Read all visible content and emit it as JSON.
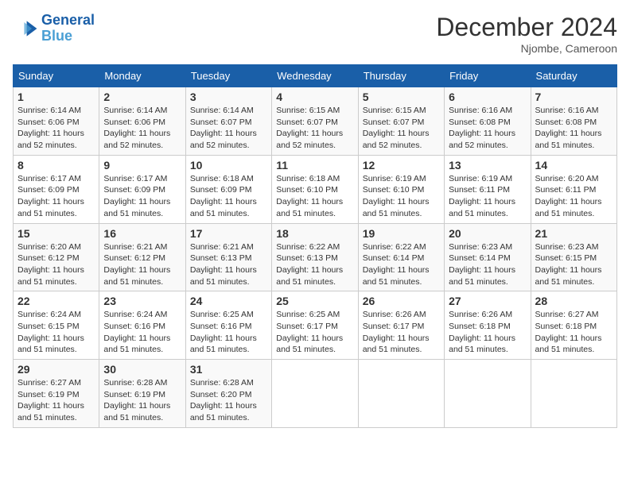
{
  "header": {
    "logo_line1": "General",
    "logo_line2": "Blue",
    "month_year": "December 2024",
    "location": "Njombe, Cameroon"
  },
  "days_of_week": [
    "Sunday",
    "Monday",
    "Tuesday",
    "Wednesday",
    "Thursday",
    "Friday",
    "Saturday"
  ],
  "weeks": [
    [
      {
        "day": "1",
        "sunrise": "6:14 AM",
        "sunset": "6:06 PM",
        "daylight": "11 hours and 52 minutes."
      },
      {
        "day": "2",
        "sunrise": "6:14 AM",
        "sunset": "6:06 PM",
        "daylight": "11 hours and 52 minutes."
      },
      {
        "day": "3",
        "sunrise": "6:14 AM",
        "sunset": "6:07 PM",
        "daylight": "11 hours and 52 minutes."
      },
      {
        "day": "4",
        "sunrise": "6:15 AM",
        "sunset": "6:07 PM",
        "daylight": "11 hours and 52 minutes."
      },
      {
        "day": "5",
        "sunrise": "6:15 AM",
        "sunset": "6:07 PM",
        "daylight": "11 hours and 52 minutes."
      },
      {
        "day": "6",
        "sunrise": "6:16 AM",
        "sunset": "6:08 PM",
        "daylight": "11 hours and 52 minutes."
      },
      {
        "day": "7",
        "sunrise": "6:16 AM",
        "sunset": "6:08 PM",
        "daylight": "11 hours and 51 minutes."
      }
    ],
    [
      {
        "day": "8",
        "sunrise": "6:17 AM",
        "sunset": "6:09 PM",
        "daylight": "11 hours and 51 minutes."
      },
      {
        "day": "9",
        "sunrise": "6:17 AM",
        "sunset": "6:09 PM",
        "daylight": "11 hours and 51 minutes."
      },
      {
        "day": "10",
        "sunrise": "6:18 AM",
        "sunset": "6:09 PM",
        "daylight": "11 hours and 51 minutes."
      },
      {
        "day": "11",
        "sunrise": "6:18 AM",
        "sunset": "6:10 PM",
        "daylight": "11 hours and 51 minutes."
      },
      {
        "day": "12",
        "sunrise": "6:19 AM",
        "sunset": "6:10 PM",
        "daylight": "11 hours and 51 minutes."
      },
      {
        "day": "13",
        "sunrise": "6:19 AM",
        "sunset": "6:11 PM",
        "daylight": "11 hours and 51 minutes."
      },
      {
        "day": "14",
        "sunrise": "6:20 AM",
        "sunset": "6:11 PM",
        "daylight": "11 hours and 51 minutes."
      }
    ],
    [
      {
        "day": "15",
        "sunrise": "6:20 AM",
        "sunset": "6:12 PM",
        "daylight": "11 hours and 51 minutes."
      },
      {
        "day": "16",
        "sunrise": "6:21 AM",
        "sunset": "6:12 PM",
        "daylight": "11 hours and 51 minutes."
      },
      {
        "day": "17",
        "sunrise": "6:21 AM",
        "sunset": "6:13 PM",
        "daylight": "11 hours and 51 minutes."
      },
      {
        "day": "18",
        "sunrise": "6:22 AM",
        "sunset": "6:13 PM",
        "daylight": "11 hours and 51 minutes."
      },
      {
        "day": "19",
        "sunrise": "6:22 AM",
        "sunset": "6:14 PM",
        "daylight": "11 hours and 51 minutes."
      },
      {
        "day": "20",
        "sunrise": "6:23 AM",
        "sunset": "6:14 PM",
        "daylight": "11 hours and 51 minutes."
      },
      {
        "day": "21",
        "sunrise": "6:23 AM",
        "sunset": "6:15 PM",
        "daylight": "11 hours and 51 minutes."
      }
    ],
    [
      {
        "day": "22",
        "sunrise": "6:24 AM",
        "sunset": "6:15 PM",
        "daylight": "11 hours and 51 minutes."
      },
      {
        "day": "23",
        "sunrise": "6:24 AM",
        "sunset": "6:16 PM",
        "daylight": "11 hours and 51 minutes."
      },
      {
        "day": "24",
        "sunrise": "6:25 AM",
        "sunset": "6:16 PM",
        "daylight": "11 hours and 51 minutes."
      },
      {
        "day": "25",
        "sunrise": "6:25 AM",
        "sunset": "6:17 PM",
        "daylight": "11 hours and 51 minutes."
      },
      {
        "day": "26",
        "sunrise": "6:26 AM",
        "sunset": "6:17 PM",
        "daylight": "11 hours and 51 minutes."
      },
      {
        "day": "27",
        "sunrise": "6:26 AM",
        "sunset": "6:18 PM",
        "daylight": "11 hours and 51 minutes."
      },
      {
        "day": "28",
        "sunrise": "6:27 AM",
        "sunset": "6:18 PM",
        "daylight": "11 hours and 51 minutes."
      }
    ],
    [
      {
        "day": "29",
        "sunrise": "6:27 AM",
        "sunset": "6:19 PM",
        "daylight": "11 hours and 51 minutes."
      },
      {
        "day": "30",
        "sunrise": "6:28 AM",
        "sunset": "6:19 PM",
        "daylight": "11 hours and 51 minutes."
      },
      {
        "day": "31",
        "sunrise": "6:28 AM",
        "sunset": "6:20 PM",
        "daylight": "11 hours and 51 minutes."
      },
      null,
      null,
      null,
      null
    ]
  ]
}
